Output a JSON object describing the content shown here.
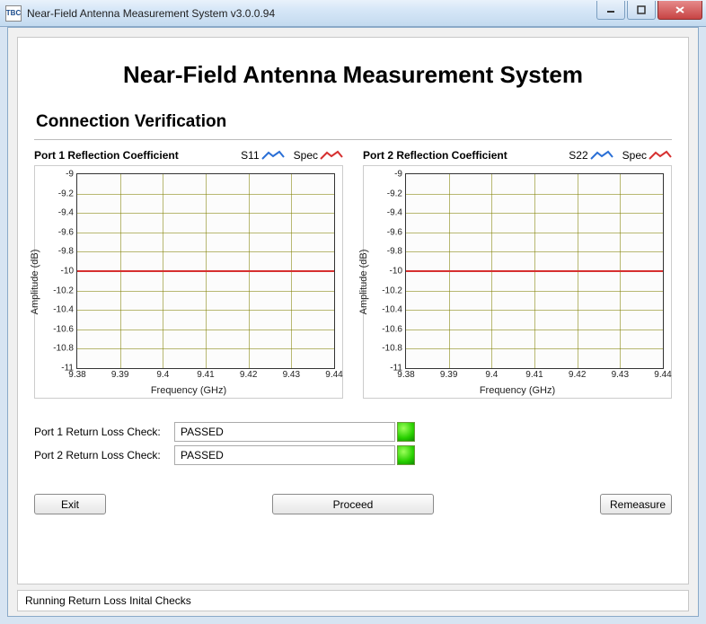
{
  "titlebar": {
    "icon_text": "TBC",
    "text": "Near-Field Antenna Measurement System v3.0.0.94"
  },
  "main": {
    "title": "Near-Field Antenna Measurement System",
    "section_title": "Connection Verification"
  },
  "charts": [
    {
      "title": "Port 1 Reflection Coefficient",
      "series_label": "S11",
      "spec_label": "Spec",
      "ylabel": "Amplitude (dB)",
      "xlabel": "Frequency (GHz)"
    },
    {
      "title": "Port 2 Reflection Coefficient",
      "series_label": "S22",
      "spec_label": "Spec",
      "ylabel": "Amplitude (dB)",
      "xlabel": "Frequency (GHz)"
    }
  ],
  "chart_data": [
    {
      "type": "line",
      "title": "Port 1 Reflection Coefficient",
      "xlabel": "Frequency (GHz)",
      "ylabel": "Amplitude (dB)",
      "xlim": [
        9.38,
        9.44
      ],
      "ylim": [
        -11,
        -9
      ],
      "xticks": [
        9.38,
        9.39,
        9.4,
        9.41,
        9.42,
        9.43,
        9.44
      ],
      "yticks": [
        -9,
        -9.2,
        -9.4,
        -9.6,
        -9.8,
        -10,
        -10.2,
        -10.4,
        -10.6,
        -10.8,
        -11
      ],
      "grid": true,
      "series": [
        {
          "name": "S11",
          "color": "#2a6fd6",
          "x": [],
          "values": []
        },
        {
          "name": "Spec",
          "color": "#d63030",
          "x": [
            9.38,
            9.44
          ],
          "values": [
            -10,
            -10
          ]
        }
      ]
    },
    {
      "type": "line",
      "title": "Port 2 Reflection Coefficient",
      "xlabel": "Frequency (GHz)",
      "ylabel": "Amplitude (dB)",
      "xlim": [
        9.38,
        9.44
      ],
      "ylim": [
        -11,
        -9
      ],
      "xticks": [
        9.38,
        9.39,
        9.4,
        9.41,
        9.42,
        9.43,
        9.44
      ],
      "yticks": [
        -9,
        -9.2,
        -9.4,
        -9.6,
        -9.8,
        -10,
        -10.2,
        -10.4,
        -10.6,
        -10.8,
        -11
      ],
      "grid": true,
      "series": [
        {
          "name": "S22",
          "color": "#2a6fd6",
          "x": [],
          "values": []
        },
        {
          "name": "Spec",
          "color": "#d63030",
          "x": [
            9.38,
            9.44
          ],
          "values": [
            -10,
            -10
          ]
        }
      ]
    }
  ],
  "status": {
    "port1_label": "Port 1 Return Loss Check:",
    "port1_value": "PASSED",
    "port1_color": "#28d000",
    "port2_label": "Port 2 Return Loss Check:",
    "port2_value": "PASSED",
    "port2_color": "#28d000"
  },
  "buttons": {
    "exit": "Exit",
    "proceed": "Proceed",
    "remeasure": "Remeasure"
  },
  "statusbar": {
    "text": "Running Return Loss Inital Checks"
  }
}
